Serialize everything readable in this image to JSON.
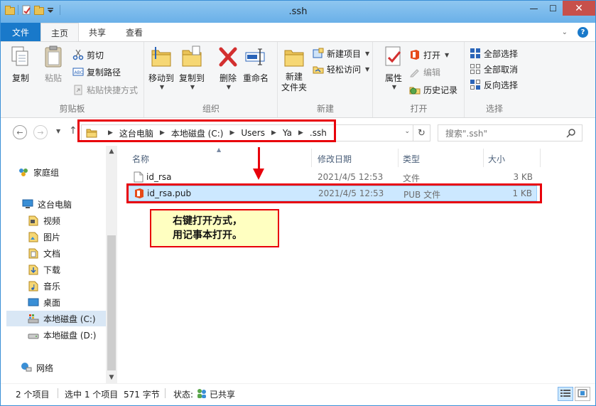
{
  "window": {
    "title": ".ssh",
    "minimize": "—",
    "maximize": "☐",
    "close": "✕"
  },
  "tabs": {
    "file": "文件",
    "home": "主页",
    "share": "共享",
    "view": "查看"
  },
  "ribbon": {
    "clipboard": {
      "label": "剪贴板",
      "copy": "复制",
      "paste": "粘贴",
      "cut": "剪切",
      "copy_path": "复制路径",
      "paste_shortcut": "粘贴快捷方式"
    },
    "organize": {
      "label": "组织",
      "move_to": "移动到",
      "copy_to": "复制到",
      "delete": "删除",
      "rename": "重命名"
    },
    "new": {
      "label": "新建",
      "new_folder": "新建\n文件夹",
      "new_folder_line1": "新建",
      "new_folder_line2": "文件夹",
      "new_item": "新建项目",
      "easy_access": "轻松访问"
    },
    "open": {
      "label": "打开",
      "properties": "属性",
      "open": "打开",
      "edit": "编辑",
      "history": "历史记录"
    },
    "select": {
      "label": "选择",
      "select_all": "全部选择",
      "select_none": "全部取消",
      "invert": "反向选择"
    }
  },
  "address": {
    "crumbs": [
      "这台电脑",
      "本地磁盘 (C:)",
      "Users",
      "Ya",
      ".ssh"
    ],
    "search_placeholder": "搜索\".ssh\""
  },
  "nav": {
    "items": [
      {
        "label": "家庭组",
        "icon": "homegroup-icon"
      },
      {
        "label": "这台电脑",
        "icon": "computer-icon"
      },
      {
        "label": "视频",
        "icon": "videos-folder-icon"
      },
      {
        "label": "图片",
        "icon": "pictures-folder-icon"
      },
      {
        "label": "文档",
        "icon": "documents-folder-icon"
      },
      {
        "label": "下载",
        "icon": "downloads-folder-icon"
      },
      {
        "label": "音乐",
        "icon": "music-folder-icon"
      },
      {
        "label": "桌面",
        "icon": "desktop-folder-icon"
      },
      {
        "label": "本地磁盘 (C:)",
        "icon": "system-drive-icon"
      },
      {
        "label": "本地磁盘 (D:)",
        "icon": "drive-icon"
      },
      {
        "label": "网络",
        "icon": "network-icon"
      }
    ]
  },
  "filelist": {
    "columns": {
      "name": "名称",
      "date": "修改日期",
      "type": "类型",
      "size": "大小"
    },
    "rows": [
      {
        "name": "id_rsa",
        "date": "2021/4/5 12:53",
        "type": "文件",
        "size": "3 KB"
      },
      {
        "name": "id_rsa.pub",
        "date": "2021/4/5 12:53",
        "type": "PUB 文件",
        "size": "1 KB"
      }
    ]
  },
  "annotation": {
    "line1": "右键打开方式，",
    "line2": "用记事本打开。"
  },
  "status": {
    "count": "2 个项目",
    "selected": "选中 1 个项目",
    "size": "571 字节",
    "state_label": "状态:",
    "state_value": "已共享"
  },
  "colors": {
    "accent": "#1979ca",
    "highlight": "#e8000b",
    "selection": "#cce8ff",
    "note_bg": "#ffffc1"
  }
}
